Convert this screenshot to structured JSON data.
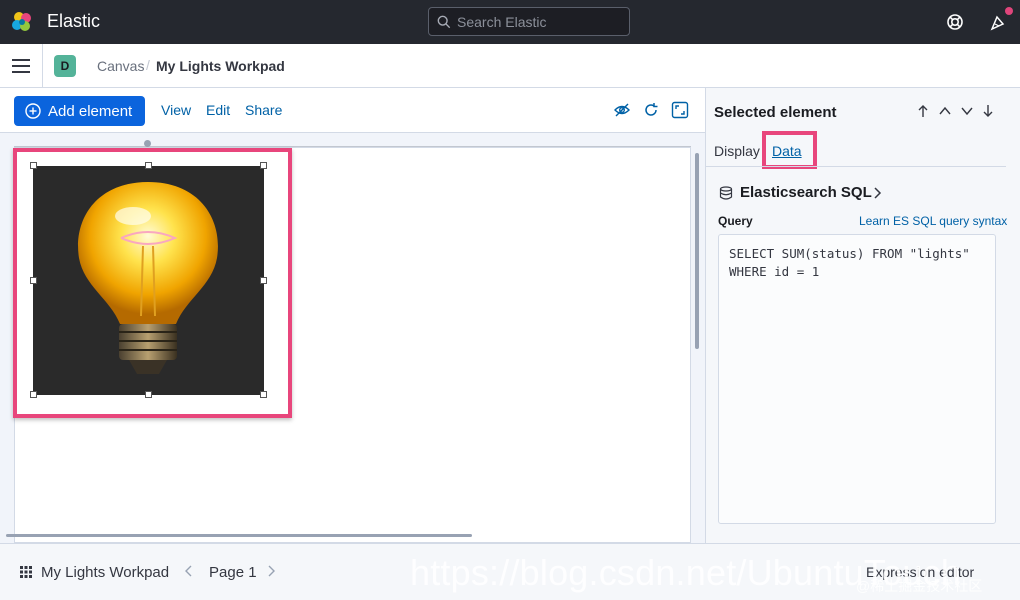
{
  "header": {
    "brand": "Elastic",
    "search_placeholder": "Search Elastic"
  },
  "breadcrumb": {
    "space_initial": "D",
    "items": [
      "Canvas",
      "My Lights Workpad"
    ],
    "separator": "/"
  },
  "toolbar": {
    "add_element": "Add element",
    "view": "View",
    "edit": "Edit",
    "share": "Share"
  },
  "sidebar": {
    "title": "Selected element",
    "tabs": [
      "Display",
      "Data"
    ],
    "active_tab": "Data",
    "datasource": "Elasticsearch SQL",
    "query_label": "Query",
    "query_link": "Learn ES SQL query syntax",
    "query": "SELECT SUM(status) FROM \"lights\"\nWHERE id = 1"
  },
  "footer": {
    "workpad_title": "My Lights Workpad",
    "page": "Page 1",
    "expression_editor": "Expression editor",
    "watermark": "https://blog.csdn.net/UbuntuTouch",
    "watermark_sub": "@稀土掘金技术社区"
  },
  "colors": {
    "header_bg": "#25282f",
    "primary": "#0b64dd",
    "link": "#0061a6",
    "highlight": "#e8467c",
    "avatar": "#54b399"
  }
}
